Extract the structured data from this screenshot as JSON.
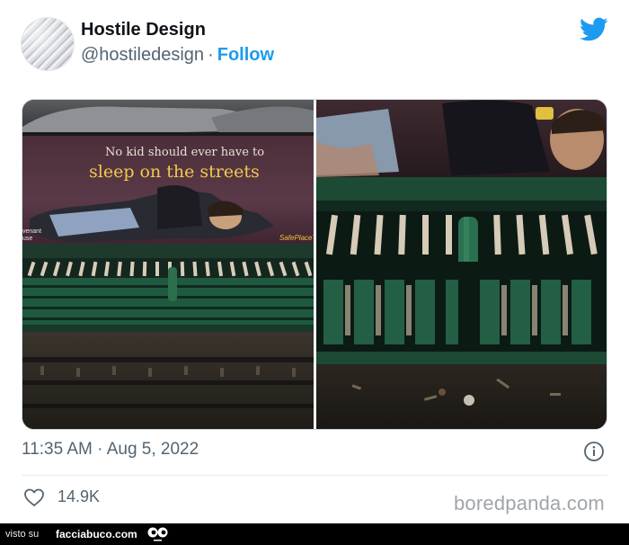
{
  "tweet": {
    "display_name": "Hostile Design",
    "handle": "@hostiledesign",
    "separator": "·",
    "follow_label": "Follow",
    "timestamp": "11:35 AM · Aug 5, 2022",
    "like_count": "14.9K"
  },
  "ad": {
    "line1": "No kid should ever have to",
    "line2": "sleep on the streets",
    "partner_fragment_1": "venant",
    "partner_fragment_2": "use",
    "brand": "SafePlaceT"
  },
  "watermark": "boredpanda.com",
  "footer": {
    "prefix": "visto su",
    "site": "facciabuco.com"
  },
  "colors": {
    "link_blue": "#1d9bf0",
    "secondary_text": "#536471",
    "bench_green": "#1f5a40",
    "ad_headline_yellow": "#f2c94c"
  },
  "icons": [
    "twitter-bird-icon",
    "info-icon",
    "heart-icon",
    "facciabuco-logo-icon"
  ]
}
